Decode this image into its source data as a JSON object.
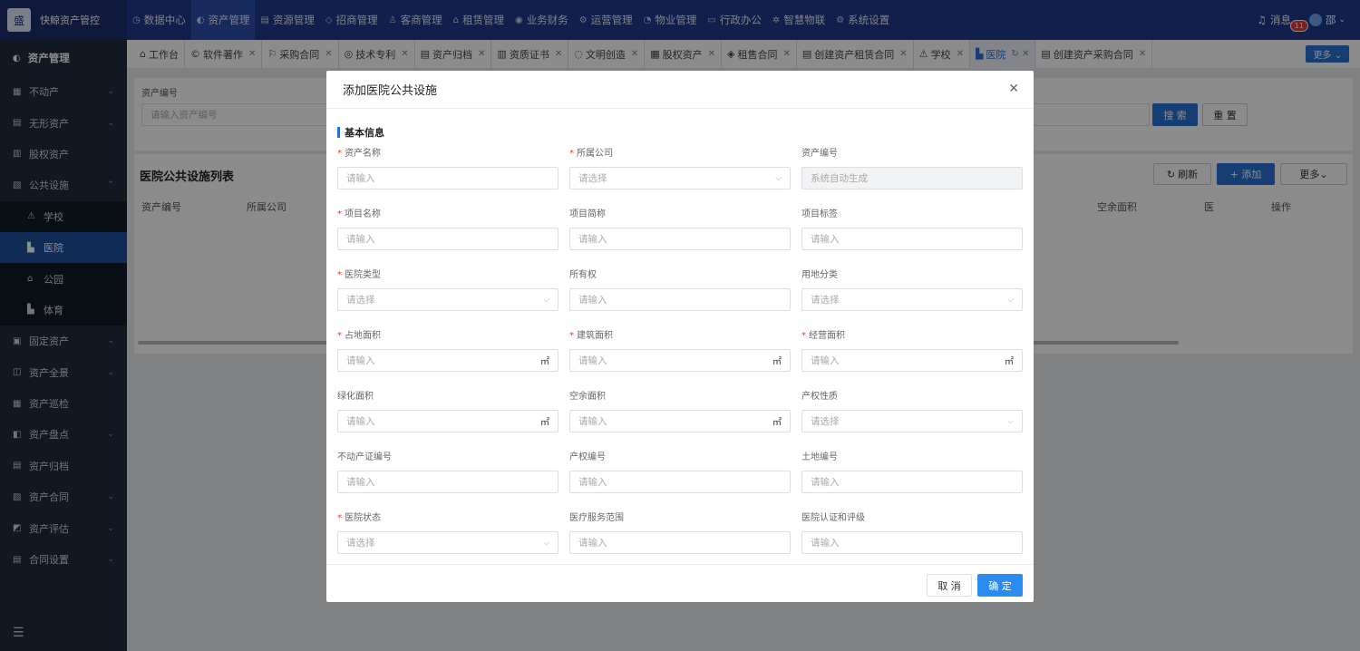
{
  "app": {
    "logo_glyph": "盛",
    "name": "快鲸资产管控"
  },
  "topnav": [
    {
      "label": "数据中心",
      "icon": "◷"
    },
    {
      "label": "资产管理",
      "icon": "◐",
      "active": true
    },
    {
      "label": "资源管理",
      "icon": "▤"
    },
    {
      "label": "招商管理",
      "icon": "◇"
    },
    {
      "label": "客商管理",
      "icon": "♙"
    },
    {
      "label": "租赁管理",
      "icon": "⌂"
    },
    {
      "label": "业务财务",
      "icon": "◉"
    },
    {
      "label": "运营管理",
      "icon": "⚙"
    },
    {
      "label": "物业管理",
      "icon": "◔"
    },
    {
      "label": "行政办公",
      "icon": "▭"
    },
    {
      "label": "智慧物联",
      "icon": "✲"
    },
    {
      "label": "系统设置",
      "icon": "⚙"
    }
  ],
  "topright": {
    "messages_label": "消息",
    "badge": "11",
    "user": "邵"
  },
  "sidebar": {
    "title": "资产管理",
    "items": [
      {
        "label": "不动产",
        "icon": "▦",
        "chev": "⌄"
      },
      {
        "label": "无形资产",
        "icon": "▤",
        "chev": "⌄"
      },
      {
        "label": "股权资产",
        "icon": "▥",
        "chev": ""
      },
      {
        "label": "公共设施",
        "icon": "▧",
        "chev": "⌃"
      },
      {
        "label": "学校",
        "icon": "⚠",
        "sub": true
      },
      {
        "label": "医院",
        "icon": "▙",
        "sub": true,
        "active": true
      },
      {
        "label": "公园",
        "icon": "⌂",
        "sub": true
      },
      {
        "label": "体育",
        "icon": "▙",
        "sub": true
      },
      {
        "label": "固定资产",
        "icon": "▣",
        "chev": "⌄"
      },
      {
        "label": "资产全景",
        "icon": "◫",
        "chev": "⌄"
      },
      {
        "label": "资产巡检",
        "icon": "▦",
        "chev": ""
      },
      {
        "label": "资产盘点",
        "icon": "◧",
        "chev": "⌄"
      },
      {
        "label": "资产归档",
        "icon": "▤",
        "chev": ""
      },
      {
        "label": "资产合同",
        "icon": "▨",
        "chev": "⌄"
      },
      {
        "label": "资产评估",
        "icon": "◩",
        "chev": "⌄"
      },
      {
        "label": "合同设置",
        "icon": "▤",
        "chev": "⌄"
      }
    ],
    "bottom_icon": "☰"
  },
  "tabs": [
    {
      "label": "工作台",
      "icon": "⌂",
      "close": ""
    },
    {
      "label": "软件著作",
      "icon": "©",
      "close": "✕"
    },
    {
      "label": "采购合同",
      "icon": "⚐",
      "close": "✕"
    },
    {
      "label": "技术专利",
      "icon": "◎",
      "close": "✕"
    },
    {
      "label": "资产归档",
      "icon": "▤",
      "close": "✕"
    },
    {
      "label": "资质证书",
      "icon": "▥",
      "close": "✕"
    },
    {
      "label": "文明创造",
      "icon": "◌",
      "close": "✕"
    },
    {
      "label": "股权资产",
      "icon": "▦",
      "close": "✕"
    },
    {
      "label": "租售合同",
      "icon": "◈",
      "close": "✕"
    },
    {
      "label": "创建资产租赁合同",
      "icon": "▤",
      "close": "✕"
    },
    {
      "label": "学校",
      "icon": "⚠",
      "close": "✕"
    },
    {
      "label": "医院",
      "icon": "▙",
      "close": "↻ ✕",
      "active": true
    },
    {
      "label": "创建资产采购合同",
      "icon": "▤",
      "close": "✕"
    }
  ],
  "tabs_more": "更多 ⌄",
  "background": {
    "filter_label": "资产编号",
    "filter_placeholder": "请输入资产编号",
    "search_btn": "搜 索",
    "reset_btn": "重 置",
    "list_title": "医院公共设施列表",
    "refresh_btn": "刷新",
    "add_btn": "+ 添加",
    "more_btn": "更多⌄",
    "col_asset_no": "资产编号",
    "col_company": "所属公司",
    "col_spare_area": "空余面积",
    "col_hospital": "医",
    "col_action": "操作"
  },
  "modal": {
    "title": "添加医院公共设施",
    "section": "基本信息",
    "fields": [
      {
        "label": "资产名称",
        "required": true,
        "placeholder": "请输入"
      },
      {
        "label": "所属公司",
        "required": true,
        "placeholder": "请选择",
        "arrow": "⌵"
      },
      {
        "label": "资产编号",
        "required": false,
        "placeholder": "系统自动生成",
        "disabled": true
      },
      {
        "label": "项目名称",
        "required": true,
        "placeholder": "请输入"
      },
      {
        "label": "项目简称",
        "required": false,
        "placeholder": "请输入"
      },
      {
        "label": "项目标签",
        "required": false,
        "placeholder": "请输入"
      },
      {
        "label": "医院类型",
        "required": true,
        "placeholder": "请选择",
        "arrow": "⌵"
      },
      {
        "label": "所有权",
        "required": false,
        "placeholder": "请输入"
      },
      {
        "label": "用地分类",
        "required": false,
        "placeholder": "请选择",
        "arrow": "⌵"
      },
      {
        "label": "占地面积",
        "required": true,
        "placeholder": "请输入",
        "suffix": "㎡"
      },
      {
        "label": "建筑面积",
        "required": true,
        "placeholder": "请输入",
        "suffix": "㎡"
      },
      {
        "label": "经营面积",
        "required": true,
        "placeholder": "请输入",
        "suffix": "㎡"
      },
      {
        "label": "绿化面积",
        "required": false,
        "placeholder": "请输入",
        "suffix": "㎡"
      },
      {
        "label": "空余面积",
        "required": false,
        "placeholder": "请输入",
        "suffix": "㎡"
      },
      {
        "label": "产权性质",
        "required": false,
        "placeholder": "请选择",
        "arrow": "⌵"
      },
      {
        "label": "不动产证编号",
        "required": false,
        "placeholder": "请输入"
      },
      {
        "label": "产权编号",
        "required": false,
        "placeholder": "请输入"
      },
      {
        "label": "土地编号",
        "required": false,
        "placeholder": "请输入"
      },
      {
        "label": "医院状态",
        "required": true,
        "placeholder": "请选择",
        "arrow": "⌵"
      },
      {
        "label": "医疗服务范围",
        "required": false,
        "placeholder": "请输入"
      },
      {
        "label": "医院认证和评级",
        "required": false,
        "placeholder": "请输入"
      }
    ],
    "cancel": "取 消",
    "ok": "确 定"
  }
}
